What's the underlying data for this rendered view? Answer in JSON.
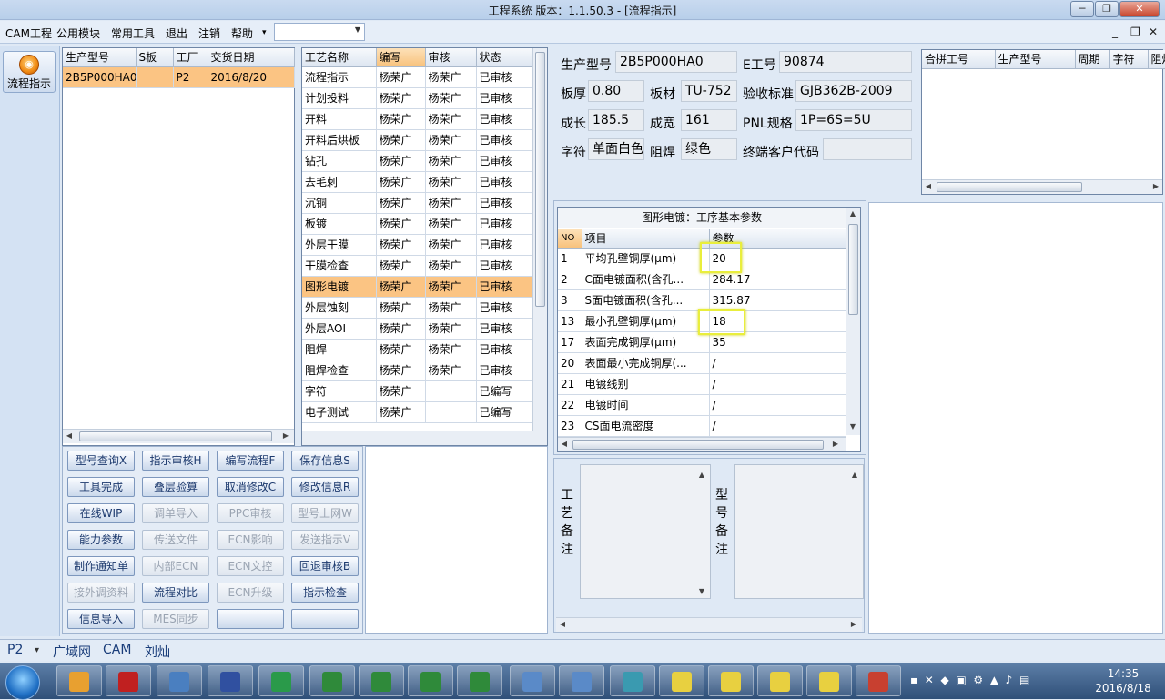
{
  "window": {
    "title": "工程系统  版本：1.1.50.3 - [流程指示]",
    "min": "─",
    "max": "❐",
    "close": "✕"
  },
  "menu": {
    "items": [
      "CAM工程",
      "公用模块",
      "常用工具",
      "退出",
      "注销",
      "帮助"
    ],
    "help_arrow": "▾",
    "combo_value": ""
  },
  "mdi": {
    "min": "_",
    "restore": "❐",
    "close": "✕"
  },
  "toolbar": {
    "flow_label": "流程指示",
    "flow_icon": "flow-icon"
  },
  "orders": {
    "headers": [
      "生产型号",
      "S板",
      "工厂",
      "交货日期"
    ],
    "rows": [
      [
        "2B5P000HA0",
        "",
        "P2",
        "2016/8/20"
      ]
    ]
  },
  "process": {
    "headers": [
      "工艺名称",
      "编写",
      "审核",
      "状态"
    ],
    "rows": [
      [
        "流程指示",
        "杨荣广",
        "杨荣广",
        "已审核"
      ],
      [
        "计划投料",
        "杨荣广",
        "杨荣广",
        "已审核"
      ],
      [
        "开料",
        "杨荣广",
        "杨荣广",
        "已审核"
      ],
      [
        "开料后烘板",
        "杨荣广",
        "杨荣广",
        "已审核"
      ],
      [
        "钻孔",
        "杨荣广",
        "杨荣广",
        "已审核"
      ],
      [
        "去毛刺",
        "杨荣广",
        "杨荣广",
        "已审核"
      ],
      [
        "沉铜",
        "杨荣广",
        "杨荣广",
        "已审核"
      ],
      [
        "板镀",
        "杨荣广",
        "杨荣广",
        "已审核"
      ],
      [
        "外层干膜",
        "杨荣广",
        "杨荣广",
        "已审核"
      ],
      [
        "干膜检查",
        "杨荣广",
        "杨荣广",
        "已审核"
      ],
      [
        "图形电镀",
        "杨荣广",
        "杨荣广",
        "已审核"
      ],
      [
        "外层蚀刻",
        "杨荣广",
        "杨荣广",
        "已审核"
      ],
      [
        "外层AOI",
        "杨荣广",
        "杨荣广",
        "已审核"
      ],
      [
        "阻焊",
        "杨荣广",
        "杨荣广",
        "已审核"
      ],
      [
        "阻焊检查",
        "杨荣广",
        "杨荣广",
        "已审核"
      ],
      [
        "字符",
        "杨荣广",
        "",
        "已编写"
      ],
      [
        "电子测试",
        "杨荣广",
        "",
        "已编写"
      ]
    ],
    "selected": 10
  },
  "actions": [
    [
      "型号查询X",
      "指示审核H",
      "编写流程F",
      "保存信息S"
    ],
    [
      "工具完成",
      "叠层验算",
      "取消修改C",
      "修改信息R"
    ],
    [
      "在线WIP",
      "调单导入",
      "PPC审核",
      "型号上网W"
    ],
    [
      "能力参数",
      "传送文件",
      "ECN影响",
      "发送指示V"
    ],
    [
      "制作通知单",
      "内部ECN",
      "ECN文控",
      "回退审核B"
    ],
    [
      "接外调资料",
      "流程对比",
      "ECN升级",
      "指示检查"
    ],
    [
      "信息导入",
      "MES同步",
      "",
      ""
    ]
  ],
  "actions_disabled": [
    [
      false,
      false,
      false,
      false
    ],
    [
      false,
      false,
      false,
      false
    ],
    [
      false,
      true,
      true,
      true
    ],
    [
      false,
      true,
      true,
      true
    ],
    [
      false,
      true,
      true,
      false
    ],
    [
      true,
      false,
      true,
      false
    ],
    [
      false,
      true,
      false,
      false
    ]
  ],
  "info": {
    "prod_model_label": "生产型号",
    "prod_model": "2B5P000HA0",
    "e_no_label": "E工号",
    "e_no": "90874",
    "thickness_label": "板厚",
    "thickness": "0.80",
    "material_label": "板材",
    "material": "TU-752",
    "standard_label": "验收标准",
    "standard": "GJB362B-2009",
    "length_label": "成长",
    "length": "185.5",
    "width_label": "成宽",
    "width": "161",
    "pnl_label": "PNL规格",
    "pnl": "1P=6S=5U",
    "char_label": "字符",
    "char": "单面白色",
    "mask_label": "阻焊",
    "mask": "绿色",
    "customer_label": "终端客户代码",
    "customer": ""
  },
  "merge": {
    "headers": [
      "合拼工号",
      "生产型号",
      "周期",
      "字符",
      "阻焊"
    ]
  },
  "params": {
    "caption": "图形电镀：工序基本参数",
    "headers": [
      "NO",
      "项目",
      "参数"
    ],
    "rows": [
      [
        "1",
        "平均孔壁铜厚(μm)",
        "20"
      ],
      [
        "2",
        "C面电镀面积(含孔...",
        "284.17"
      ],
      [
        "3",
        "S面电镀面积(含孔...",
        "315.87"
      ],
      [
        "13",
        "最小孔壁铜厚(μm)",
        "18"
      ],
      [
        "17",
        "表面完成铜厚(μm)",
        "35"
      ],
      [
        "20",
        "表面最小完成铜厚(...",
        "/"
      ],
      [
        "21",
        "电镀线别",
        "/"
      ],
      [
        "22",
        "电镀时间",
        "/"
      ],
      [
        "23",
        "CS面电流密度",
        "/"
      ]
    ]
  },
  "notes": {
    "process_label": [
      "工",
      "艺",
      "备",
      "注"
    ],
    "model_label": [
      "型",
      "号",
      "备",
      "注"
    ]
  },
  "status": {
    "factory": "P2",
    "arrow": "▾",
    "items": [
      "广域网",
      "CAM",
      "刘灿"
    ]
  },
  "taskbar": {
    "time": "14:35",
    "date": "2016/8/18"
  },
  "colors": {
    "selected_row": "#fbc483",
    "highlight_box": "#e9ee3c",
    "window_bg": "#dfe9f5"
  }
}
